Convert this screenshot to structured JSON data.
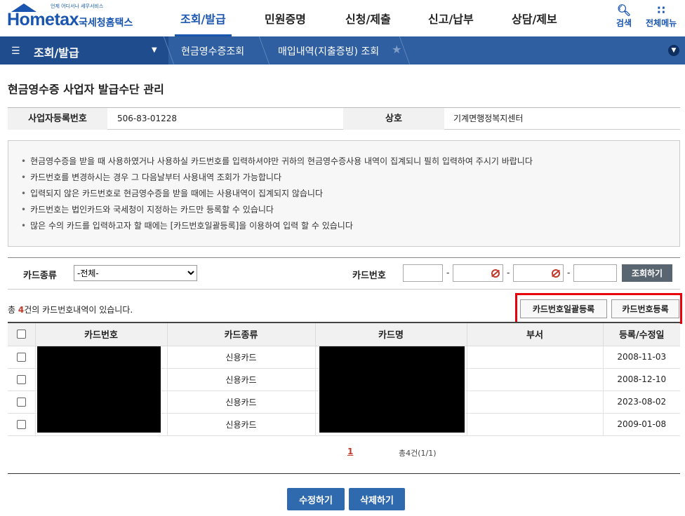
{
  "header": {
    "logo_tag": "언제 어디서나 세무서비스",
    "logo_word": "Hometax",
    "logo_kr": "국세청홈택스",
    "nav": [
      "조회/발급",
      "민원증명",
      "신청/제출",
      "신고/납부",
      "상담/제보"
    ],
    "search_label": "검색",
    "allmenu_label": "전체메뉴"
  },
  "bar": {
    "menu_title": "조회/발급",
    "crumbs": [
      "현금영수증조회",
      "매입내역(지출증빙) 조회"
    ]
  },
  "page_title": "현금영수증 사업자 발급수단 관리",
  "info": {
    "reg_label": "사업자등록번호",
    "reg_value": "506-83-01228",
    "name_label": "상호",
    "name_value": "기계면행정복지센터"
  },
  "notices": [
    "현금영수증을 받을 때 사용하였거나 사용하실 카드번호를 입력하셔야만 귀하의 현금영수증사용 내역이 집계되니 필히 입력하여 주시기 바랍니다",
    "카드번호를 변경하시는 경우 그 다음날부터 사용내역 조회가 가능합니다",
    "입력되지 않은 카드번호로 현금영수증을 받을 때에는 사용내역이 집계되지 않습니다",
    "카드번호는 법인카드와 국세청이 지정하는 카드만 등록할 수 있습니다",
    "많은 수의 카드를 입력하고자 할 때에는 [카드번호일괄등록]을 이용하여 입력 할 수 있습니다"
  ],
  "search": {
    "card_type_label": "카드종류",
    "card_type_value": "-전체-",
    "card_no_label": "카드번호",
    "query_button": "조회하기"
  },
  "count": {
    "prefix": "총 ",
    "num": "4",
    "suffix": "건의 카드번호내역이 있습니다."
  },
  "buttons": {
    "bulk": "카드번호일괄등록",
    "register": "카드번호등록",
    "edit": "수정하기",
    "delete": "삭제하기"
  },
  "grid": {
    "headers": [
      "카드번호",
      "카드종류",
      "카드명",
      "부서",
      "등록/수정일"
    ],
    "rows": [
      {
        "type": "신용카드",
        "date": "2008-11-03"
      },
      {
        "type": "신용카드",
        "date": "2008-12-10"
      },
      {
        "type": "신용카드",
        "date": "2023-08-02"
      },
      {
        "type": "신용카드",
        "date": "2009-01-08"
      }
    ]
  },
  "pagination": {
    "current": "1",
    "summary": "총4건(1/1)"
  },
  "colors": {
    "brand": "#1a56b0",
    "bar": "#2f5fa0",
    "button_blue": "#2f6aae",
    "highlight": "#e8000b"
  }
}
